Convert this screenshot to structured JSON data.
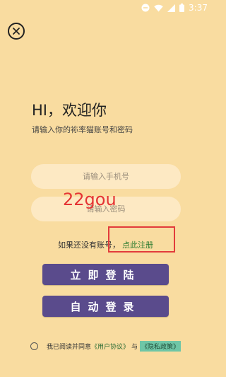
{
  "status_bar": {
    "time": "3:37"
  },
  "greeting": "HI，欢迎你",
  "subtitle": "请输入你的袮率猫账号和密码",
  "phone_field": {
    "placeholder": "请输入手机号",
    "value": ""
  },
  "password_field": {
    "placeholder": "请输入密码",
    "value": ""
  },
  "watermark": "22gou",
  "register": {
    "prompt": "如果还没有账号，",
    "link": "点此注册"
  },
  "buttons": {
    "login": "立即登陆",
    "auto_login": "自动登录"
  },
  "agreement": {
    "text": "我已阅读并同意",
    "user_agreement": "《用户协议》",
    "and": "与",
    "privacy_policy": "《隐私政策》"
  },
  "colors": {
    "background": "#f9dca0",
    "button": "#5a4b8c",
    "link": "#2a7a2e",
    "highlight": "#e23b3b"
  }
}
